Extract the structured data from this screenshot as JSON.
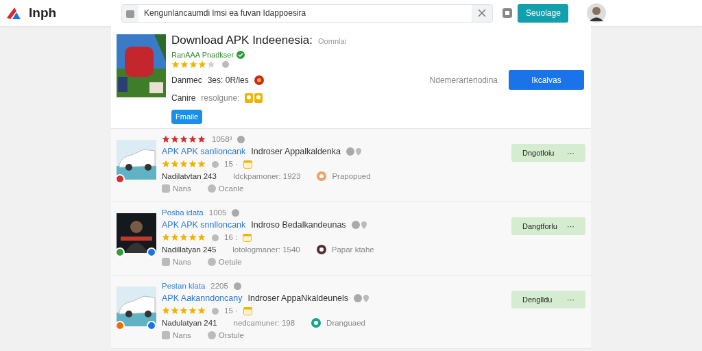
{
  "header": {
    "logo": "Inph",
    "search": {
      "value": "Kengunlancaumdi lmsi ea fuvan Idappoesira"
    },
    "button": "Seuolage"
  },
  "featured": {
    "title": "Download APK Indeenesia:",
    "subtitle": "Oomnlai",
    "developer": "RanAAA Pnadkser",
    "stars": 4,
    "detail_label": "Danmec",
    "detail_value": "3es: 0R/les",
    "category_label": "Canire",
    "category_value": "resolgune:",
    "tag": "Fmaile",
    "side_text": "Ndemerarteriodina",
    "button": "Ikcalvas"
  },
  "items": [
    {
      "badges": [
        {
          "color": "#d32f2f"
        }
      ],
      "top": {
        "kind": "stars",
        "stars": 5,
        "count": "1058³"
      },
      "link": "APK  APK sanlioncank",
      "title": "Indroser Appalkaldenka",
      "stars": 5,
      "count": "15 ·",
      "stat1": "Nadilatvtan 243",
      "stat2": "Idckpamoner: 1923",
      "extra": "Prapopued",
      "foot1": "Nans",
      "foot2": "Ocanle",
      "button": "Dngotloiu",
      "more": "···"
    },
    {
      "badges": [
        {
          "color": "#2e9d3a"
        },
        {
          "color": "#1a73e8"
        }
      ],
      "top": {
        "kind": "label",
        "label": "Posba idata",
        "count": "1005"
      },
      "link": "APK  APK snnlloncank",
      "title": "Indroso Bedalkandeunas",
      "stars": 5,
      "count": "16 :",
      "stat1": "Nadillatyan 245",
      "stat2": "lotologmaner: 1540",
      "extra": "Papar ktahe",
      "foot1": "Nans",
      "foot2": "Oetule",
      "button": "Dangtforlu",
      "more": "···"
    },
    {
      "badges": [
        {
          "color": "#ef6c00"
        },
        {
          "color": "#1a73e8"
        }
      ],
      "top": {
        "kind": "label",
        "label": "Pestan klata",
        "count": "2205"
      },
      "link": "APK  Aakanndoncany",
      "title": "Indroser AppaNkaldeunels",
      "stars": 5,
      "count": "15 ·",
      "stat1": "Nadulatyan 241",
      "stat2": "nedcamuner: 198",
      "extra": "Dranguaed",
      "foot1": "Nans",
      "foot2": "Orstule",
      "button": "Denglldu",
      "more": "···"
    }
  ]
}
